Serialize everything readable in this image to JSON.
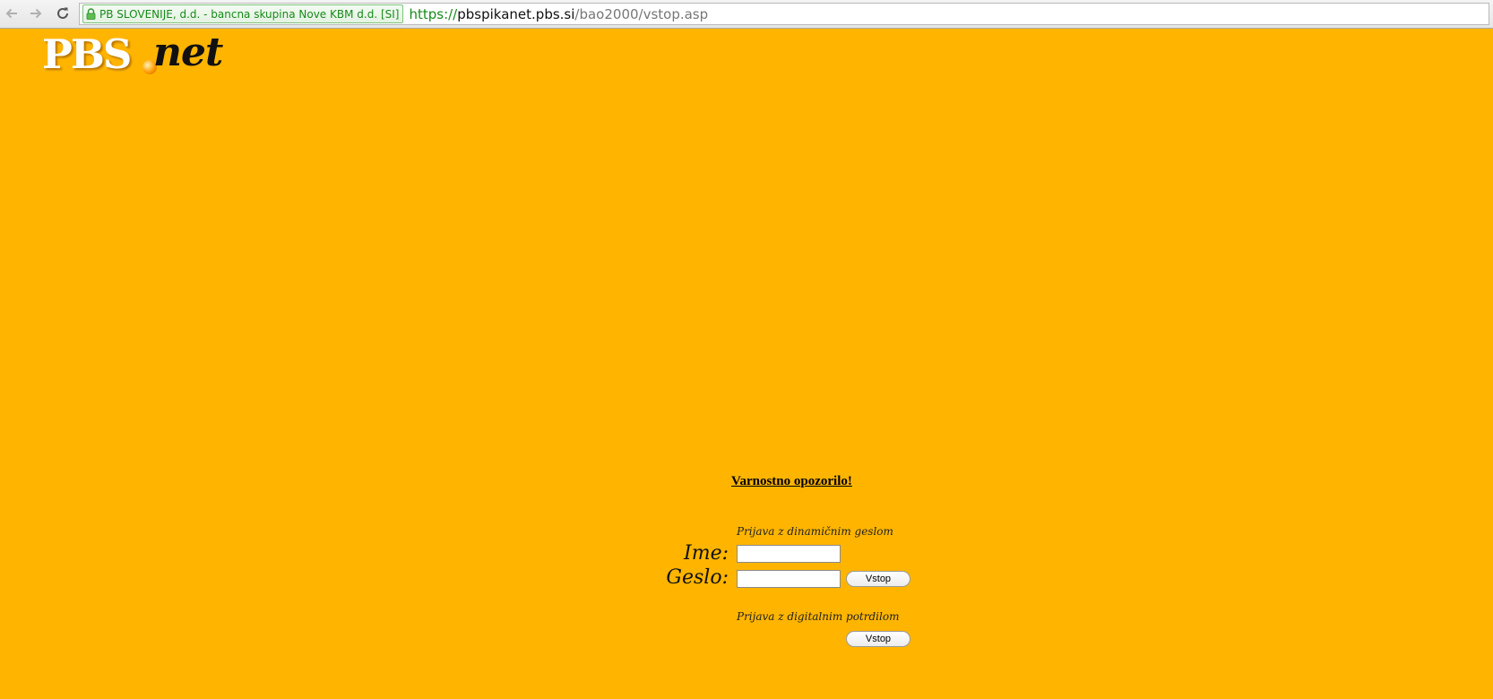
{
  "browser": {
    "icons": {
      "back": "back-arrow-icon",
      "forward": "forward-arrow-icon",
      "reload": "reload-icon",
      "lock": "lock-icon"
    },
    "ev_certificate": "PB SLOVENIJE, d.d. - bancna skupina Nove KBM d.d. [SI]",
    "url": {
      "scheme": "https://",
      "host": "pbspikanet.pbs.si",
      "path": "/bao2000/vstop.asp"
    }
  },
  "logo": {
    "brand": "PBS",
    "suffix": "net"
  },
  "page": {
    "background_color": "#ffb500",
    "security_warning_link": "Varnostno opozorilo!",
    "dynamic_login": {
      "title": "Prijava z dinamičnim geslom",
      "username_label": "Ime:",
      "username_value": "",
      "password_label": "Geslo:",
      "password_value": "",
      "submit_label": "Vstop"
    },
    "certificate_login": {
      "title": "Prijava z digitalnim potrdilom",
      "submit_label": "Vstop"
    }
  }
}
